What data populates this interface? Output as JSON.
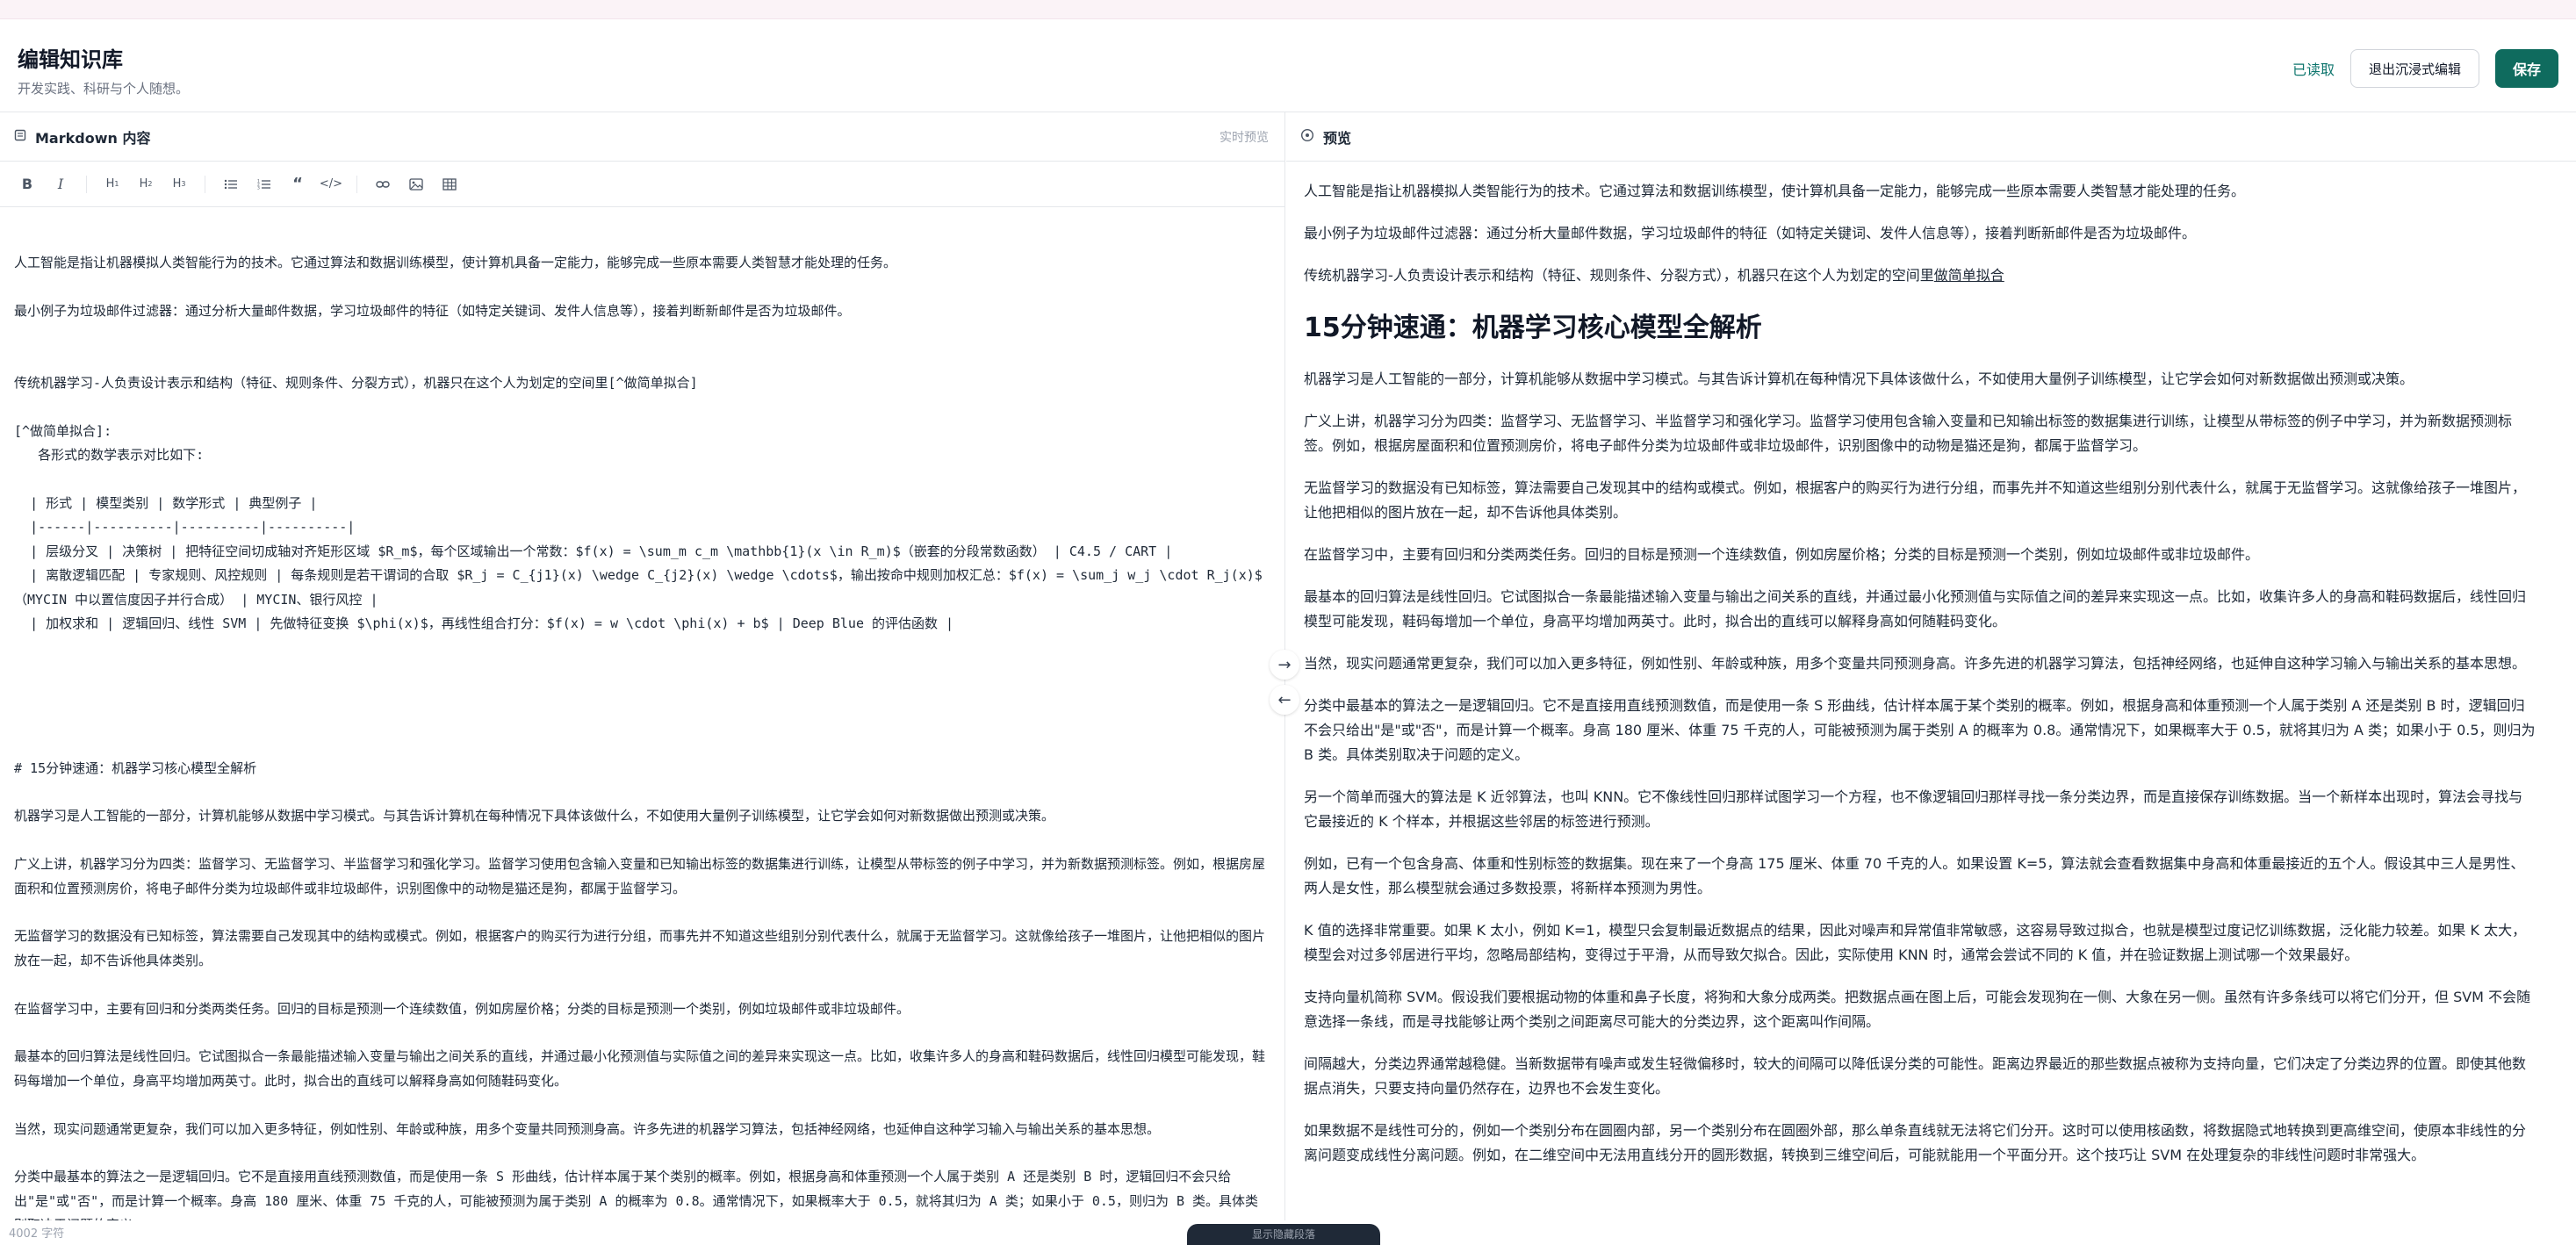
{
  "header": {
    "title": "编辑知识库",
    "subtitle": "开发实践、科研与个人随想。",
    "status_label": "已读取",
    "exit_label": "退出沉浸式编辑",
    "save_label": "保存"
  },
  "editor": {
    "title": "Markdown 内容",
    "hint": "实时预览",
    "word_count": "4002 字符",
    "toolbar": [
      "B",
      "I",
      "H1",
      "H2",
      "H3",
      "UL",
      "OL",
      "Quote",
      "Code",
      "Link",
      "Image",
      "Table"
    ],
    "content": "人工智能是指让机器模拟人类智能行为的技术。它通过算法和数据训练模型，使计算机具备一定能力，能够完成一些原本需要人类智慧才能处理的任务。\n\n最小例子为垃圾邮件过滤器：通过分析大量邮件数据，学习垃圾邮件的特征（如特定关键词、发件人信息等），接着判断新邮件是否为垃圾邮件。\n\n\n传统机器学习-人负责设计表示和结构（特征、规则条件、分裂方式），机器只在这个人为划定的空间里[^做简单拟合]\n\n[^做简单拟合]:\n   各形式的数学表示对比如下:\n\n  | 形式 | 模型类别 | 数学形式 | 典型例子 |\n  |------|----------|----------|----------|\n  | 层级分叉 | 决策树 | 把特征空间切成轴对齐矩形区域 $R_m$，每个区域输出一个常数：$f(x) = \\sum_m c_m \\mathbb{1}(x \\in R_m)$（嵌套的分段常数函数） | C4.5 / CART |\n  | 离散逻辑匹配 | 专家规则、风控规则 | 每条规则是若干谓词的合取 $R_j = C_{j1}(x) \\wedge C_{j2}(x) \\wedge \\cdots$，输出按命中规则加权汇总：$f(x) = \\sum_j w_j \\cdot R_j(x)$（MYCIN 中以置信度因子并行合成） | MYCIN、银行风控 |\n  | 加权求和 | 逻辑回归、线性 SVM | 先做特征变换 $\\phi(x)$，再线性组合打分：$f(x) = w \\cdot \\phi(x) + b$ | Deep Blue 的评估函数 |\n\n\n\n\n\n# 15分钟速通：机器学习核心模型全解析\n\n机器学习是人工智能的一部分，计算机能够从数据中学习模式。与其告诉计算机在每种情况下具体该做什么，不如使用大量例子训练模型，让它学会如何对新数据做出预测或决策。\n\n广义上讲，机器学习分为四类：监督学习、无监督学习、半监督学习和强化学习。监督学习使用包含输入变量和已知输出标签的数据集进行训练，让模型从带标签的例子中学习，并为新数据预测标签。例如，根据房屋面积和位置预测房价，将电子邮件分类为垃圾邮件或非垃圾邮件，识别图像中的动物是猫还是狗，都属于监督学习。\n\n无监督学习的数据没有已知标签，算法需要自己发现其中的结构或模式。例如，根据客户的购买行为进行分组，而事先并不知道这些组别分别代表什么，就属于无监督学习。这就像给孩子一堆图片，让他把相似的图片放在一起，却不告诉他具体类别。\n\n在监督学习中，主要有回归和分类两类任务。回归的目标是预测一个连续数值，例如房屋价格；分类的目标是预测一个类别，例如垃圾邮件或非垃圾邮件。\n\n最基本的回归算法是线性回归。它试图拟合一条最能描述输入变量与输出之间关系的直线，并通过最小化预测值与实际值之间的差异来实现这一点。比如，收集许多人的身高和鞋码数据后，线性回归模型可能发现，鞋码每增加一个单位，身高平均增加两英寸。此时，拟合出的直线可以解释身高如何随鞋码变化。\n\n当然，现实问题通常更复杂，我们可以加入更多特征，例如性别、年龄或种族，用多个变量共同预测身高。许多先进的机器学习算法，包括神经网络，也延伸自这种学习输入与输出关系的基本思想。\n\n分类中最基本的算法之一是逻辑回归。它不是直接用直线预测数值，而是使用一条 S 形曲线，估计样本属于某个类别的概率。例如，根据身高和体重预测一个人属于类别 A 还是类别 B 时，逻辑回归不会只给出\"是\"或\"否\"，而是计算一个概率。身高 180 厘米、体重 75 千克的人，可能被预测为属于类别 A 的概率为 0.8。通常情况下，如果概率大于 0.5，就将其归为 A 类；如果小于 0.5，则归为 B 类。具体类别取决于问题的定义。"
  },
  "preview": {
    "title": "预览",
    "intro": [
      "人工智能是指让机器模拟人类智能行为的技术。它通过算法和数据训练模型，使计算机具备一定能力，能够完成一些原本需要人类智慧才能处理的任务。",
      "最小例子为垃圾邮件过滤器：通过分析大量邮件数据，学习垃圾邮件的特征（如特定关键词、发件人信息等），接着判断新邮件是否为垃圾邮件。"
    ],
    "trad_text": "传统机器学习-人负责设计表示和结构（特征、规则条件、分裂方式），机器只在这个人为划定的空间里",
    "trad_link": "做简单拟合",
    "heading": "15分钟速通：机器学习核心模型全解析",
    "paragraphs": [
      "机器学习是人工智能的一部分，计算机能够从数据中学习模式。与其告诉计算机在每种情况下具体该做什么，不如使用大量例子训练模型，让它学会如何对新数据做出预测或决策。",
      "广义上讲，机器学习分为四类：监督学习、无监督学习、半监督学习和强化学习。监督学习使用包含输入变量和已知输出标签的数据集进行训练，让模型从带标签的例子中学习，并为新数据预测标签。例如，根据房屋面积和位置预测房价，将电子邮件分类为垃圾邮件或非垃圾邮件，识别图像中的动物是猫还是狗，都属于监督学习。",
      "无监督学习的数据没有已知标签，算法需要自己发现其中的结构或模式。例如，根据客户的购买行为进行分组，而事先并不知道这些组别分别代表什么，就属于无监督学习。这就像给孩子一堆图片，让他把相似的图片放在一起，却不告诉他具体类别。",
      "在监督学习中，主要有回归和分类两类任务。回归的目标是预测一个连续数值，例如房屋价格；分类的目标是预测一个类别，例如垃圾邮件或非垃圾邮件。",
      "最基本的回归算法是线性回归。它试图拟合一条最能描述输入变量与输出之间关系的直线，并通过最小化预测值与实际值之间的差异来实现这一点。比如，收集许多人的身高和鞋码数据后，线性回归模型可能发现，鞋码每增加一个单位，身高平均增加两英寸。此时，拟合出的直线可以解释身高如何随鞋码变化。",
      "当然，现实问题通常更复杂，我们可以加入更多特征，例如性别、年龄或种族，用多个变量共同预测身高。许多先进的机器学习算法，包括神经网络，也延伸自这种学习输入与输出关系的基本思想。",
      "分类中最基本的算法之一是逻辑回归。它不是直接用直线预测数值，而是使用一条 S 形曲线，估计样本属于某个类别的概率。例如，根据身高和体重预测一个人属于类别 A 还是类别 B 时，逻辑回归不会只给出\"是\"或\"否\"，而是计算一个概率。身高 180 厘米、体重 75 千克的人，可能被预测为属于类别 A 的概率为 0.8。通常情况下，如果概率大于 0.5，就将其归为 A 类；如果小于 0.5，则归为 B 类。具体类别取决于问题的定义。",
      "另一个简单而强大的算法是 K 近邻算法，也叫 KNN。它不像线性回归那样试图学习一个方程，也不像逻辑回归那样寻找一条分类边界，而是直接保存训练数据。当一个新样本出现时，算法会寻找与它最接近的 K 个样本，并根据这些邻居的标签进行预测。",
      "例如，已有一个包含身高、体重和性别标签的数据集。现在来了一个身高 175 厘米、体重 70 千克的人。如果设置 K=5，算法就会查看数据集中身高和体重最接近的五个人。假设其中三人是男性、两人是女性，那么模型就会通过多数投票，将新样本预测为男性。",
      "K 值的选择非常重要。如果 K 太小，例如 K=1，模型只会复制最近数据点的结果，因此对噪声和异常值非常敏感，这容易导致过拟合，也就是模型过度记忆训练数据，泛化能力较差。如果 K 太大，模型会对过多邻居进行平均，忽略局部结构，变得过于平滑，从而导致欠拟合。因此，实际使用 KNN 时，通常会尝试不同的 K 值，并在验证数据上测试哪一个效果最好。",
      "支持向量机简称 SVM。假设我们要根据动物的体重和鼻子长度，将狗和大象分成两类。把数据点画在图上后，可能会发现狗在一侧、大象在另一侧。虽然有许多条线可以将它们分开，但 SVM 不会随意选择一条线，而是寻找能够让两个类别之间距离尽可能大的分类边界，这个距离叫作间隔。",
      "间隔越大，分类边界通常越稳健。当新数据带有噪声或发生轻微偏移时，较大的间隔可以降低误分类的可能性。距离边界最近的那些数据点被称为支持向量，它们决定了分类边界的位置。即使其他数据点消失，只要支持向量仍然存在，边界也不会发生变化。",
      "如果数据不是线性可分的，例如一个类别分布在圆圈内部，另一个类别分布在圆圈外部，那么单条直线就无法将它们分开。这时可以使用核函数，将数据隐式地转换到更高维空间，使原本非线性的分离问题变成线性分离问题。例如，在二维空间中无法用直线分开的圆形数据，转换到三维空间后，可能就能用一个平面分开。这个技巧让 SVM 在处理复杂的非线性问题时非常强大。"
    ]
  },
  "bottom_pill": "显示隐藏段落"
}
